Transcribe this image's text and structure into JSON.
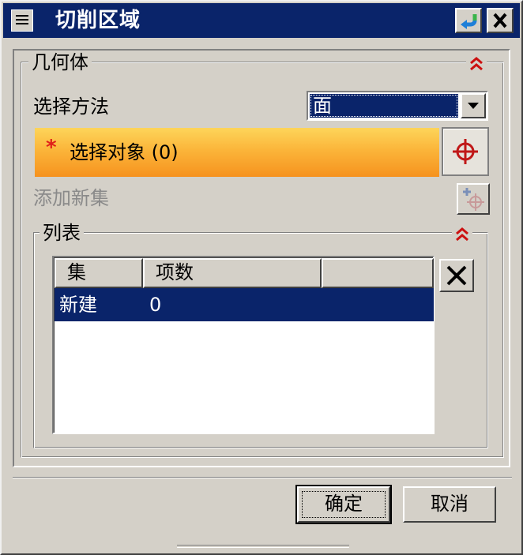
{
  "window": {
    "title": "切削区域"
  },
  "geometry_group": {
    "title": "几何体",
    "select_method_label": "选择方法",
    "select_method_value": "面",
    "select_object_label": "选择对象 (0)",
    "add_new_set_label": "添加新集"
  },
  "list_group": {
    "title": "列表",
    "columns": [
      "集",
      "项数",
      ""
    ],
    "rows": [
      {
        "set": "新建",
        "count": "0"
      }
    ]
  },
  "buttons": {
    "ok": "确定",
    "cancel": "取消"
  },
  "icons": {
    "required_marker": "asterisk-icon",
    "reset": "reset-arrow-icon",
    "close": "close-icon",
    "collapse": "double-chevron-up-icon",
    "select_object": "crosshair-icon",
    "add_set": "add-set-icon",
    "delete": "delete-x-icon"
  },
  "colors": {
    "titlebar": "#0a246a",
    "selection": "#0a246a",
    "highlight_bar_top": "#fdd55a",
    "highlight_bar_bottom": "#f6921e",
    "required_star": "#e0201a",
    "collapse_arrows": "#cc1010"
  }
}
